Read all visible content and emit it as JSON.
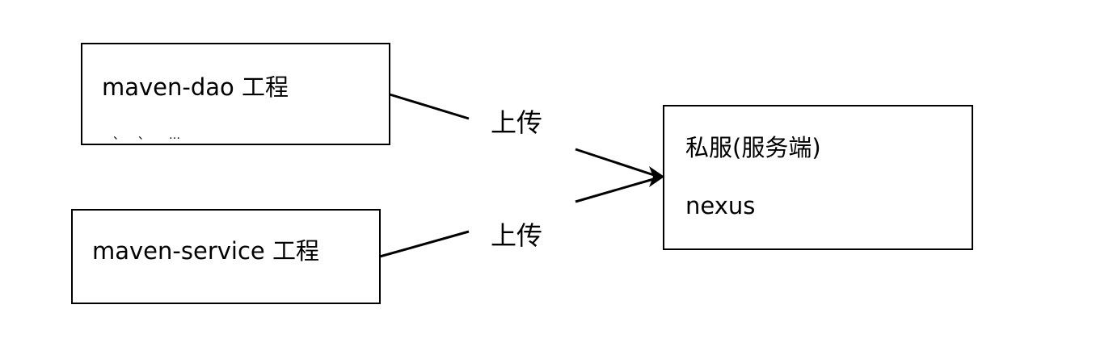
{
  "nodes": {
    "dao": {
      "label": "maven-dao 工程"
    },
    "service": {
      "label": "maven-service 工程"
    },
    "server": {
      "title": "私服(服务端)",
      "subtitle": "nexus"
    }
  },
  "edges": {
    "upload_top": {
      "label": "上传"
    },
    "upload_bottom": {
      "label": "上传"
    }
  }
}
